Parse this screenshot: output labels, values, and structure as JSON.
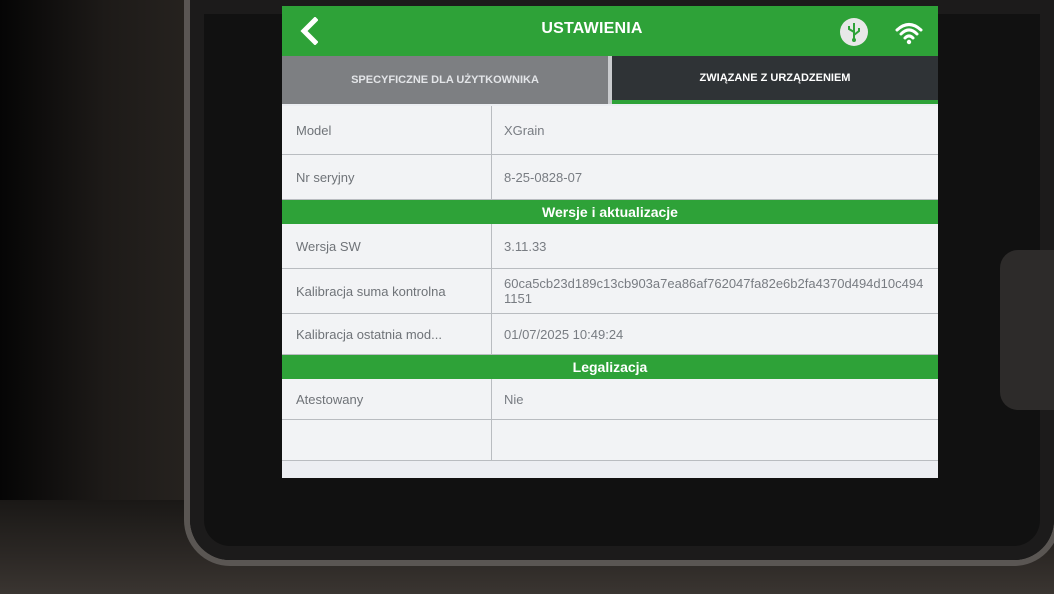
{
  "header": {
    "title": "USTAWIENIA",
    "back_icon": "chevron-left-icon",
    "usb_icon": "usb-icon",
    "wifi_icon": "wifi-icon",
    "accent_color": "#2ea238"
  },
  "tabs": [
    {
      "label": "SPECYFICZNE DLA UŻYTKOWNIKA",
      "active": false
    },
    {
      "label": "ZWIĄZANE Z URZĄDZENIEM",
      "active": true
    }
  ],
  "device_info": [
    {
      "label": "Model",
      "value": "XGrain"
    },
    {
      "label": "Nr seryjny",
      "value": "8-25-0828-07"
    }
  ],
  "versions": {
    "heading": "Wersje i aktualizacje",
    "rows": [
      {
        "label": "Wersja SW",
        "value": "3.11.33"
      },
      {
        "label": "Kalibracja suma kontrolna",
        "value": "60ca5cb23d189c13cb903a7ea86af762047fa82e6b2fa4370d494d10c4941151"
      },
      {
        "label": "Kalibracja ostatnia mod...",
        "value": "01/07/2025 10:49:24"
      }
    ]
  },
  "legalization": {
    "heading": "Legalizacja",
    "rows": [
      {
        "label": "Atestowany",
        "value": "Nie"
      },
      {
        "label": "",
        "value": ""
      }
    ]
  }
}
